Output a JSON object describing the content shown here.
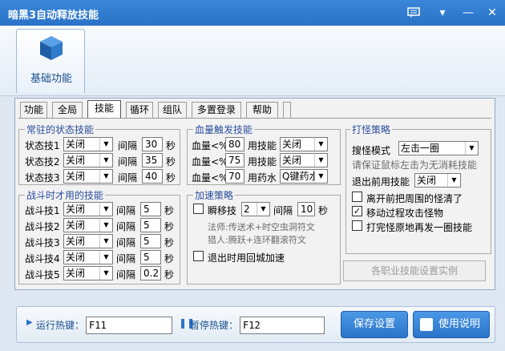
{
  "window": {
    "title": "暗黑3自动释放技能",
    "menu_icon": "chat-menu-icon",
    "minimize_icon": "minimize-icon",
    "close_icon": "close-icon"
  },
  "ribbon": {
    "basic_label": "基础功能",
    "icon": "cube-icon"
  },
  "tabs": [
    {
      "label": "功能"
    },
    {
      "label": "全局"
    },
    {
      "label": "技能"
    },
    {
      "label": "循环"
    },
    {
      "label": "组队"
    },
    {
      "label": "多置登录"
    },
    {
      "label": "帮助"
    }
  ],
  "active_tab": "技能",
  "resident": {
    "title": "常驻的状态技能",
    "interval_label": "间隔",
    "unit": "秒",
    "rows": [
      {
        "label": "状态技1",
        "value": "关闭",
        "interval": "30"
      },
      {
        "label": "状态技2",
        "value": "关闭",
        "interval": "35"
      },
      {
        "label": "状态技3",
        "value": "关闭",
        "interval": "40"
      }
    ]
  },
  "battle": {
    "title": "战斗时才用的技能",
    "interval_label": "间隔",
    "unit": "秒",
    "rows": [
      {
        "label": "战斗技1",
        "value": "关闭",
        "interval": "5"
      },
      {
        "label": "战斗技2",
        "value": "关闭",
        "interval": "5"
      },
      {
        "label": "战斗技3",
        "value": "关闭",
        "interval": "5"
      },
      {
        "label": "战斗技4",
        "value": "关闭",
        "interval": "5"
      },
      {
        "label": "战斗技5",
        "value": "关闭",
        "interval": "0.2"
      }
    ]
  },
  "hp": {
    "title": "血量触发技能",
    "rows": [
      {
        "label": "血量<%",
        "value": "80",
        "use_label": "用技能",
        "select": "关闭"
      },
      {
        "label": "血量<%",
        "value": "75",
        "use_label": "用技能",
        "select": "关闭"
      },
      {
        "label": "血量<%",
        "value": "70",
        "use_label": "用药水",
        "select": "Q键药水"
      }
    ]
  },
  "speed": {
    "title": "加速策略",
    "instant_label": "瞬移技",
    "instant_value": "2",
    "interval_label": "间隔",
    "interval_value": "10",
    "unit": "秒",
    "hint1": "法师:传送术+时空虫洞符文",
    "hint2": "猎人:腾跃+连环翻滚符文",
    "city_label": "退出时用回城加速",
    "instant_checked": false,
    "city_checked": false
  },
  "strategy": {
    "title": "打怪策略",
    "mode_label": "搜怪模式",
    "mode_value": "左击一圈",
    "note": "请保证鼠标左击为无消耗技能",
    "exit_label": "退出前用技能",
    "exit_value": "关闭",
    "opt1": "离开前把周围的怪清了",
    "opt2": "移动过程攻击怪物",
    "opt3": "打完怪原地再发一圈技能",
    "opt1_checked": false,
    "opt2_checked": true,
    "opt3_checked": false,
    "example_button": "各职业技能设置实例"
  },
  "bottom": {
    "run_label": "运行热键：",
    "run_value": "F11",
    "pause_label": "暂停热键：",
    "pause_value": "F12",
    "save_button": "保存设置",
    "help_button": "使用说明",
    "play_icon": "play-icon",
    "pause_icon": "pause-icon",
    "help_icon": "book-icon"
  }
}
